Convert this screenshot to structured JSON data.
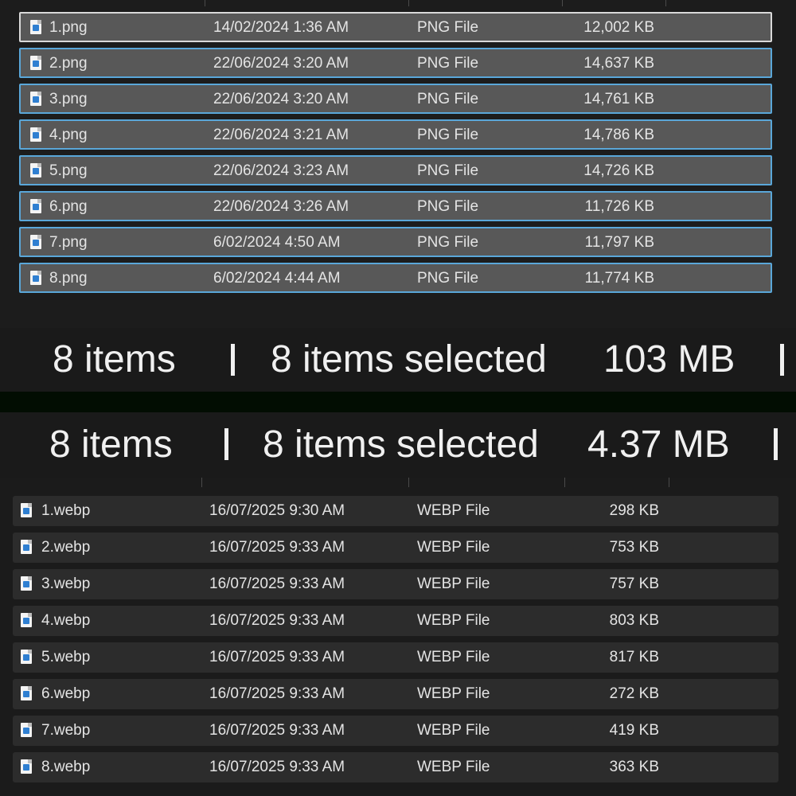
{
  "top_list": {
    "rows": [
      {
        "name": "1.png",
        "date": "14/02/2024 1:36 AM",
        "type": "PNG File",
        "size": "12,002 KB"
      },
      {
        "name": "2.png",
        "date": "22/06/2024 3:20 AM",
        "type": "PNG File",
        "size": "14,637 KB"
      },
      {
        "name": "3.png",
        "date": "22/06/2024 3:20 AM",
        "type": "PNG File",
        "size": "14,761 KB"
      },
      {
        "name": "4.png",
        "date": "22/06/2024 3:21 AM",
        "type": "PNG File",
        "size": "14,786 KB"
      },
      {
        "name": "5.png",
        "date": "22/06/2024 3:23 AM",
        "type": "PNG File",
        "size": "14,726 KB"
      },
      {
        "name": "6.png",
        "date": "22/06/2024 3:26 AM",
        "type": "PNG File",
        "size": "11,726 KB"
      },
      {
        "name": "7.png",
        "date": "6/02/2024 4:50 AM",
        "type": "PNG File",
        "size": "11,797 KB"
      },
      {
        "name": "8.png",
        "date": "6/02/2024 4:44 AM",
        "type": "PNG File",
        "size": "11,774 KB"
      }
    ]
  },
  "status_top": {
    "item_count": "8 items",
    "selected": "8 items selected",
    "total_size": "103 MB"
  },
  "status_bottom": {
    "item_count": "8 items",
    "selected": "8 items selected",
    "total_size": "4.37 MB"
  },
  "bottom_list": {
    "rows": [
      {
        "name": "1.webp",
        "date": "16/07/2025 9:30 AM",
        "type": "WEBP File",
        "size": "298 KB"
      },
      {
        "name": "2.webp",
        "date": "16/07/2025 9:33 AM",
        "type": "WEBP File",
        "size": "753 KB"
      },
      {
        "name": "3.webp",
        "date": "16/07/2025 9:33 AM",
        "type": "WEBP File",
        "size": "757 KB"
      },
      {
        "name": "4.webp",
        "date": "16/07/2025 9:33 AM",
        "type": "WEBP File",
        "size": "803 KB"
      },
      {
        "name": "5.webp",
        "date": "16/07/2025 9:33 AM",
        "type": "WEBP File",
        "size": "817 KB"
      },
      {
        "name": "6.webp",
        "date": "16/07/2025 9:33 AM",
        "type": "WEBP File",
        "size": "272 KB"
      },
      {
        "name": "7.webp",
        "date": "16/07/2025 9:33 AM",
        "type": "WEBP File",
        "size": "419 KB"
      },
      {
        "name": "8.webp",
        "date": "16/07/2025 9:33 AM",
        "type": "WEBP File",
        "size": "363 KB"
      }
    ]
  },
  "colors": {
    "selection_border": "#5aa7d9",
    "selected_row_bg": "#585858",
    "row_bg": "#2c2c2c",
    "window_bg": "#1c1c1c"
  },
  "icons": {
    "file": "image-file-icon"
  }
}
